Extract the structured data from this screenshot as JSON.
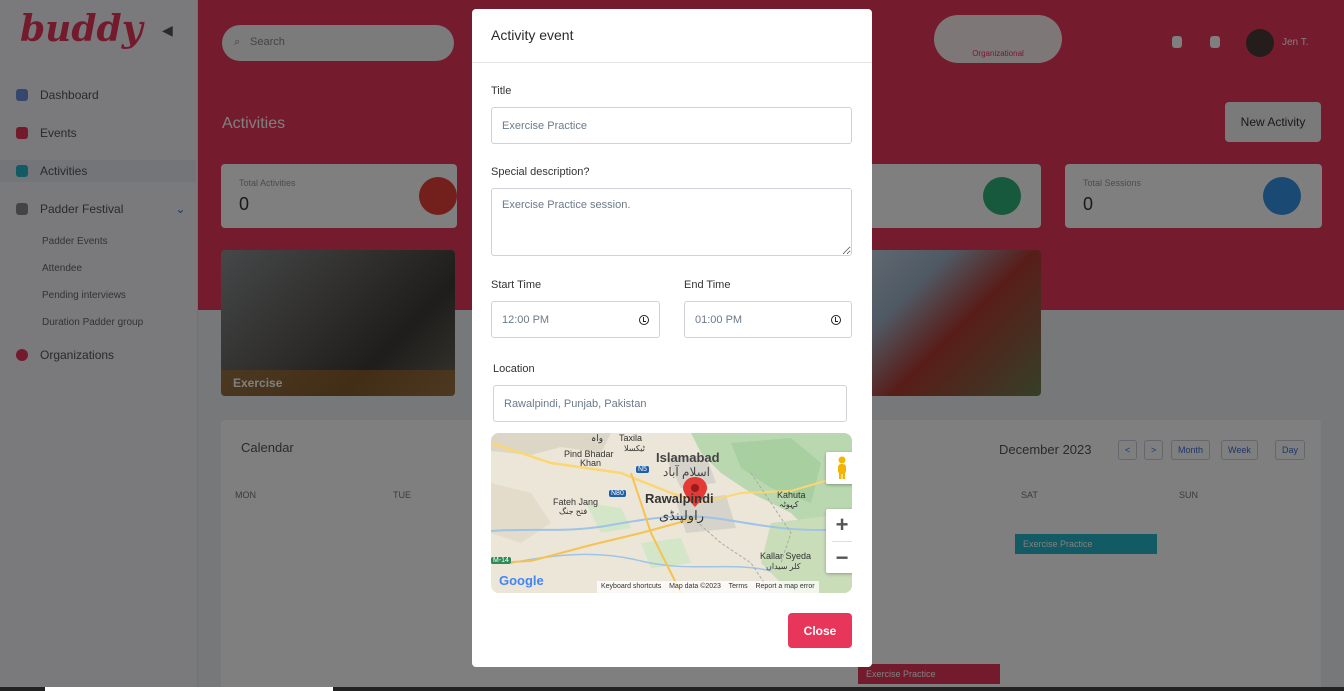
{
  "app": {
    "logo": "buddy",
    "user_name": "Jen T.",
    "search_placeholder": "Search",
    "org_pill_label": "Organizational"
  },
  "sidebar": {
    "items": [
      {
        "label": "Dashboard",
        "icon": "dashboard-icon"
      },
      {
        "label": "Events",
        "icon": "calendar-icon"
      },
      {
        "label": "Activities",
        "icon": "activities-icon"
      },
      {
        "label": "Padder Festival",
        "icon": "padder-icon"
      },
      {
        "label": "Organizations",
        "icon": "organizations-icon"
      }
    ],
    "subitems": [
      "Padder Events",
      "Attendee",
      "Pending interviews",
      "Duration Padder group"
    ]
  },
  "page": {
    "title": "Activities",
    "new_activity_label": "New Activity",
    "stats": [
      {
        "label": "Total Activities",
        "value": "0"
      },
      {
        "label": "Total Sessions",
        "value": "0"
      }
    ],
    "photo_caption": "Exercise",
    "calendar": {
      "title": "Calendar",
      "month": "December 2023",
      "controls": [
        "<",
        ">",
        "Month",
        "Week",
        "Day"
      ],
      "days": [
        "MON",
        "TUE",
        "SAT",
        "SUN"
      ],
      "events": [
        "Exercise Practice",
        "Exercise Practice"
      ]
    }
  },
  "modal": {
    "title": "Activity event",
    "title_label": "Title",
    "title_value": "Exercise Practice",
    "description_label": "Special description?",
    "description_value": "Exercise Practice session.",
    "start_label": "Start Time",
    "start_value": "12:00 PM",
    "end_label": "End Time",
    "end_value": "01:00 PM",
    "location_label": "Location",
    "location_value": "Rawalpindi, Punjab, Pakistan",
    "close_label": "Close"
  },
  "map": {
    "labels": {
      "islamabad": "Islamabad",
      "islamabad_ur": "اسلام آباد",
      "rawalpindi": "Rawalpindi",
      "rawalpindi_ur": "راولپنڈی",
      "taxila": "Taxila",
      "taxila_ur": "ٹیکسلا",
      "wah": "واہ",
      "pind_bhadar": "Pind Bhadar",
      "khan": "Khan",
      "fateh_jang": "Fateh Jang",
      "fateh_jang_ur": "فتح جنگ",
      "kahuta": "Kahuta",
      "kahuta_ur": "کہوٹہ",
      "kallar_syeda": "Kallar Syeda",
      "kallar_syeda_ur": "کلر سیداں",
      "n5": "N5",
      "n80": "N80",
      "m14": "M-14"
    },
    "attribution": [
      "Keyboard shortcuts",
      "Map data ©2023",
      "Terms",
      "Report a map error"
    ],
    "zoom_in": "+",
    "zoom_out": "−",
    "google": "Google"
  },
  "colors": {
    "brand": "#e7365a",
    "overlay": "rgba(0,0,0,0.5)"
  }
}
